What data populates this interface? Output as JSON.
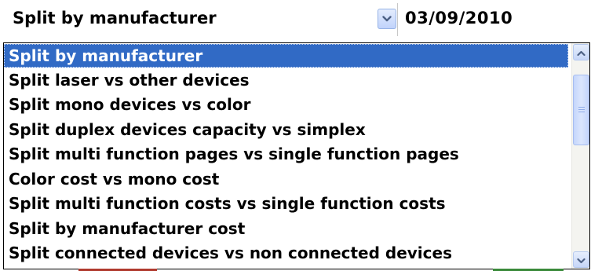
{
  "selector": {
    "selected_value": "Split by manufacturer",
    "dropdown_icon": "chevron-down-icon"
  },
  "date": {
    "value": "03/09/2010"
  },
  "dropdown": {
    "options": [
      {
        "label": "Split by manufacturer",
        "selected": true
      },
      {
        "label": "Split laser vs other devices",
        "selected": false
      },
      {
        "label": "Split mono devices vs color",
        "selected": false
      },
      {
        "label": "Split duplex devices capacity vs simplex",
        "selected": false
      },
      {
        "label": "Split multi function pages vs single function pages",
        "selected": false
      },
      {
        "label": "Color cost vs mono cost",
        "selected": false
      },
      {
        "label": "Split multi function costs vs single function costs",
        "selected": false
      },
      {
        "label": "Split by manufacturer cost",
        "selected": false
      },
      {
        "label": "Split connected devices vs non connected devices",
        "selected": false
      }
    ],
    "scrollbar": {
      "up_icon": "scroll-up-arrow-icon",
      "down_icon": "scroll-down-arrow-icon"
    }
  },
  "colors": {
    "selection_bg": "#316ac5",
    "selection_text": "#ffffff",
    "scroll_button": "#c6d6f8",
    "peek_red": "#b03a2e",
    "peek_green": "#3a8a3a"
  }
}
